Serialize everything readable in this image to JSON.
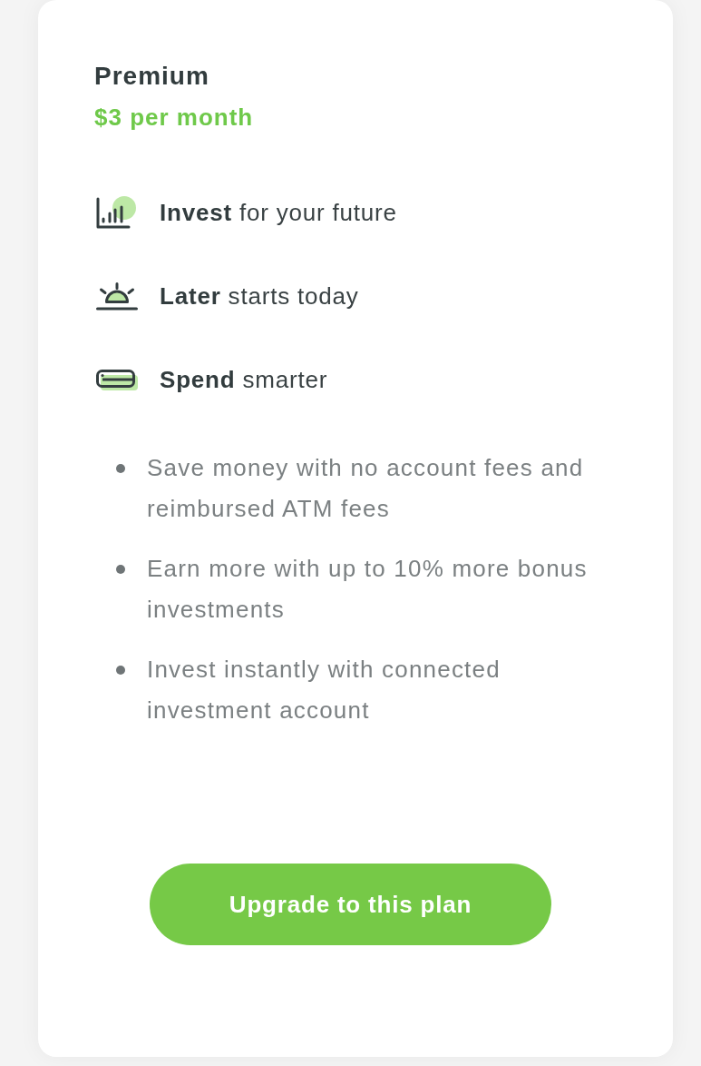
{
  "plan": {
    "name": "Premium",
    "price": "$3 per month"
  },
  "features": [
    {
      "kind": "chart",
      "text": "**Invest** for your future"
    },
    {
      "kind": "sunrise",
      "text": "**Later** starts today"
    },
    {
      "kind": "card",
      "text": "**Spend** smarter"
    }
  ],
  "benefits": [
    "Save money with no account fees and reimbursed ATM fees",
    "Earn more with up to 10% more bonus investments",
    "Invest instantly with connected investment account"
  ],
  "button": {
    "label": "Upgrade to this plan"
  }
}
